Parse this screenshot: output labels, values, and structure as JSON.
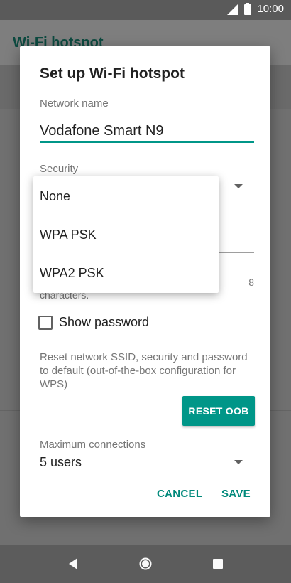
{
  "status_bar": {
    "time": "10:00"
  },
  "app": {
    "title": "Wi-Fi hotspot"
  },
  "dialog": {
    "title": "Set up Wi-Fi hotspot",
    "network_name_label": "Network name",
    "network_name_value": "Vodafone Smart N9",
    "security_label": "Security",
    "password_hint_visible": "characters.",
    "password_hint_num": "8",
    "show_password_label": "Show password",
    "show_password_checked": false,
    "reset_description": "Reset network SSID, security and password to default (out-of-the-box configuration for WPS)",
    "reset_button_label": "RESET OOB",
    "max_connections_label": "Maximum connections",
    "max_connections_value": "5 users",
    "cancel_label": "CANCEL",
    "save_label": "SAVE"
  },
  "security_dropdown": {
    "options": [
      "None",
      "WPA PSK",
      "WPA2 PSK"
    ]
  },
  "colors": {
    "accent": "#009688",
    "dialog_bg": "#ffffff",
    "scrim": "#6e6e6e"
  },
  "icons": {
    "signal": "signal-icon",
    "battery": "battery-icon",
    "back": "back-icon",
    "home": "home-icon",
    "recents": "recents-icon"
  }
}
